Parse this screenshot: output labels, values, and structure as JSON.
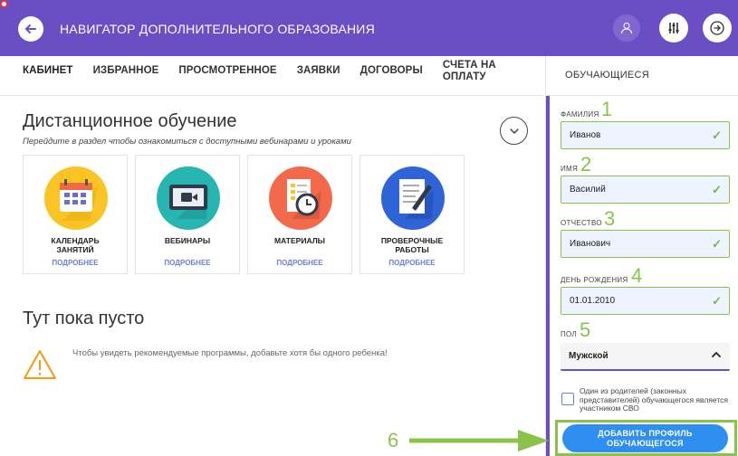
{
  "header": {
    "title": "НАВИГАТОР ДОПОЛНИТЕЛЬНОГО ОБРАЗОВАНИЯ",
    "color": "#6a4fc4"
  },
  "tabs": [
    {
      "label": "КАБИНЕТ",
      "active": true
    },
    {
      "label": "ИЗБРАННОЕ"
    },
    {
      "label": "ПРОСМОТРЕННОЕ"
    },
    {
      "label": "ЗАЯВКИ"
    },
    {
      "label": "ДОГОВОРЫ"
    },
    {
      "label_line1": "СЧЕТА НА",
      "label_line2": "ОПЛАТУ"
    }
  ],
  "distance": {
    "title": "Дистанционное обучение",
    "subtitle": "Перейдите в раздел чтобы ознакомиться с доступными вебинарами и уроками",
    "cards": [
      {
        "title_line1": "КАЛЕНДАРЬ",
        "title_line2": "ЗАНЯТИЙ",
        "more": "ПОДРОБНЕЕ",
        "icon": "calendar-icon",
        "color": "#f9c424"
      },
      {
        "title_line1": "ВЕБИНАРЫ",
        "title_line2": "",
        "more": "ПОДРОБНЕЕ",
        "icon": "video-camera-icon",
        "color": "#26b5b0"
      },
      {
        "title_line1": "МАТЕРИАЛЫ",
        "title_line2": "",
        "more": "ПОДРОБНЕЕ",
        "icon": "clock-document-icon",
        "color": "#f26a4b"
      },
      {
        "title_line1": "ПРОВЕРОЧНЫЕ",
        "title_line2": "РАБОТЫ",
        "more": "ПОДРОБНЕЕ",
        "icon": "pencil-document-icon",
        "color": "#2f63d8"
      }
    ]
  },
  "empty": {
    "title": "Тут пока пусто",
    "text": "Чтобы увидеть рекомендуемые программы, добавьте хотя бы одного ребенка!"
  },
  "student_panel": {
    "title": "ОБУЧАЮЩИЕСЯ",
    "fields": [
      {
        "label": "ФАМИЛИЯ",
        "num": "1",
        "value": "Иванов"
      },
      {
        "label": "ИМЯ",
        "num": "2",
        "value": "Василий"
      },
      {
        "label": "ОТЧЕСТВО",
        "num": "3",
        "value": "Иванович"
      },
      {
        "label": "ДЕНЬ РОЖДЕНИЯ",
        "num": "4",
        "value": "01.01.2010"
      }
    ],
    "gender": {
      "label": "ПОЛ",
      "num": "5",
      "value": "Мужской"
    },
    "checkbox_text": "Один из родителей (законных представителей) обучающегося является участником СВО",
    "add_button_line1": "ДОБАВИТЬ ПРОФИЛЬ",
    "add_button_line2": "ОБУЧАЮЩЕГОСЯ",
    "step6": "6"
  }
}
